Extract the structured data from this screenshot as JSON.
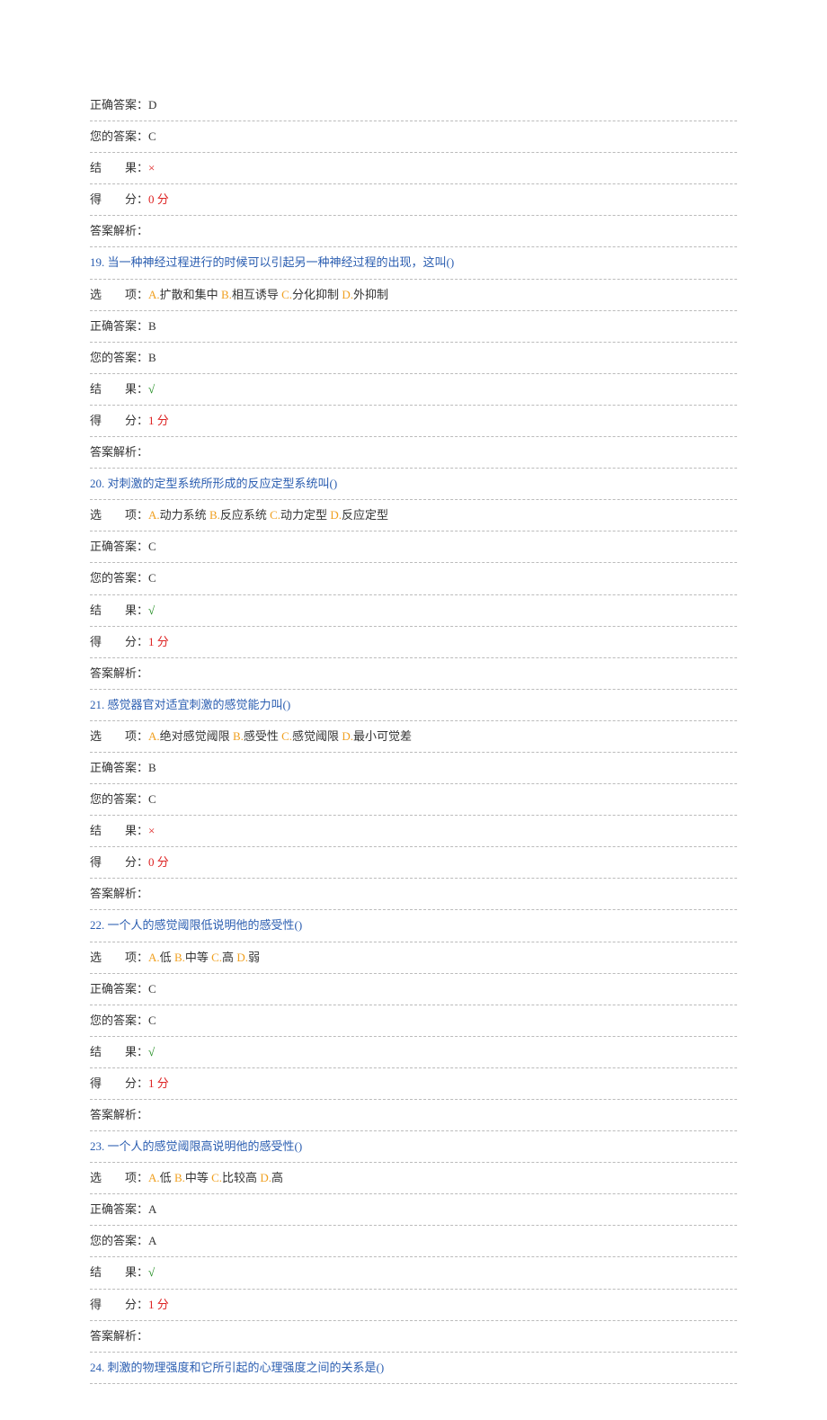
{
  "labels": {
    "correct": "正确答案",
    "your": "您的答案",
    "result": "结　　果",
    "score": "得　　分",
    "explain": "答案解析",
    "options": "选　　项",
    "scoreUnit": " 分"
  },
  "q18": {
    "correct": "D",
    "your": "C",
    "resultMark": "×",
    "resultOk": false,
    "score": "0",
    "explain": ""
  },
  "questions": [
    {
      "num": "19.",
      "text": "当一种神经过程进行的时候可以引起另一种神经过程的出现，这叫()",
      "opts": [
        {
          "k": "A.",
          "v": "扩散和集中"
        },
        {
          "k": "B.",
          "v": "相互诱导"
        },
        {
          "k": "C.",
          "v": "分化抑制"
        },
        {
          "k": "D.",
          "v": "外抑制"
        }
      ],
      "correct": "B",
      "your": "B",
      "resultMark": "√",
      "resultOk": true,
      "score": "1",
      "explain": ""
    },
    {
      "num": "20.",
      "text": "对刺激的定型系统所形成的反应定型系统叫()",
      "opts": [
        {
          "k": "A.",
          "v": "动力系统"
        },
        {
          "k": "B.",
          "v": "反应系统"
        },
        {
          "k": "C.",
          "v": "动力定型"
        },
        {
          "k": "D.",
          "v": "反应定型"
        }
      ],
      "correct": "C",
      "your": "C",
      "resultMark": "√",
      "resultOk": true,
      "score": "1",
      "explain": ""
    },
    {
      "num": "21.",
      "text": "感觉器官对适宜刺激的感觉能力叫()",
      "opts": [
        {
          "k": "A.",
          "v": "绝对感觉阈限"
        },
        {
          "k": "B.",
          "v": "感受性"
        },
        {
          "k": "C.",
          "v": "感觉阈限"
        },
        {
          "k": "D.",
          "v": "最小可觉差"
        }
      ],
      "correct": "B",
      "your": "C",
      "resultMark": "×",
      "resultOk": false,
      "score": "0",
      "explain": ""
    },
    {
      "num": "22.",
      "text": "一个人的感觉阈限低说明他的感受性()",
      "opts": [
        {
          "k": "A.",
          "v": "低"
        },
        {
          "k": "B.",
          "v": "中等"
        },
        {
          "k": "C.",
          "v": "高"
        },
        {
          "k": "D.",
          "v": "弱"
        }
      ],
      "correct": "C",
      "your": "C",
      "resultMark": "√",
      "resultOk": true,
      "score": "1",
      "explain": ""
    },
    {
      "num": "23.",
      "text": "一个人的感觉阈限高说明他的感受性()",
      "opts": [
        {
          "k": "A.",
          "v": "低"
        },
        {
          "k": "B.",
          "v": "中等"
        },
        {
          "k": "C.",
          "v": "比较高"
        },
        {
          "k": "D.",
          "v": "高"
        }
      ],
      "correct": "A",
      "your": "A",
      "resultMark": "√",
      "resultOk": true,
      "score": "1",
      "explain": ""
    }
  ],
  "q24": {
    "num": "24.",
    "text": "刺激的物理强度和它所引起的心理强度之间的关系是()"
  }
}
